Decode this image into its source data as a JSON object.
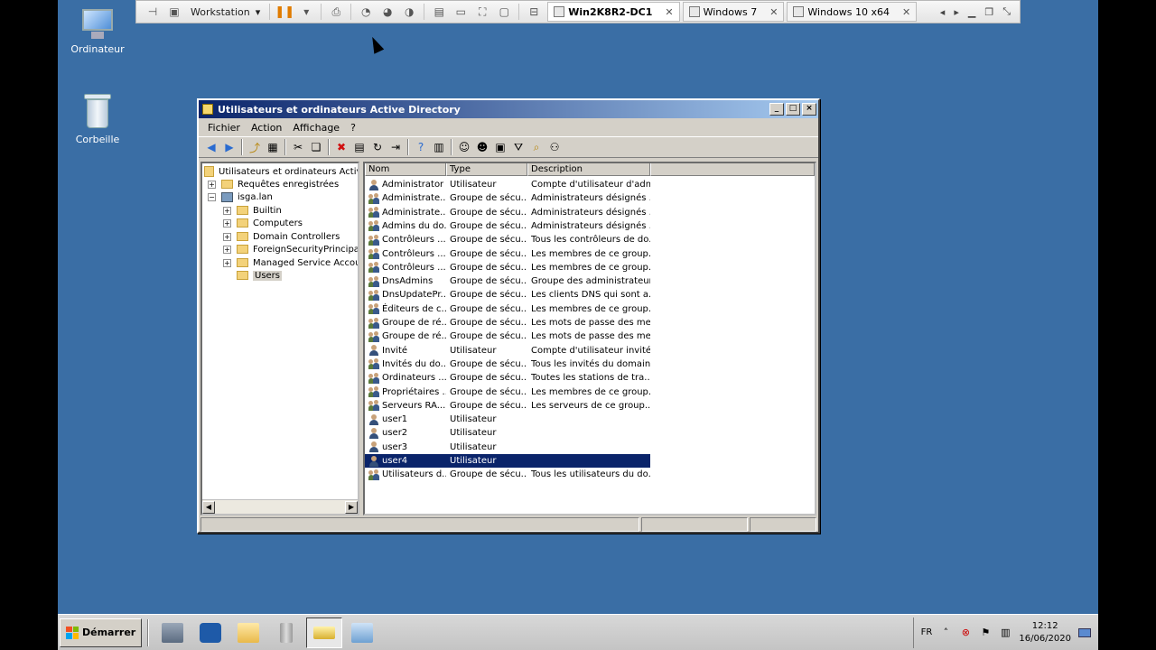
{
  "vmware": {
    "workstation_label": "Workstation",
    "tabs": [
      {
        "label": "Win2K8R2-DC1",
        "active": true
      },
      {
        "label": "Windows 7",
        "active": false
      },
      {
        "label": "Windows 10 x64",
        "active": false
      }
    ],
    "close_glyph": "✕"
  },
  "desktop": {
    "computer_label": "Ordinateur",
    "recycle_label": "Corbeille"
  },
  "window": {
    "title": "Utilisateurs et ordinateurs Active Directory",
    "menu": [
      "Fichier",
      "Action",
      "Affichage",
      "?"
    ]
  },
  "tree": {
    "root": "Utilisateurs et ordinateurs Active Di",
    "saved_queries": "Requêtes enregistrées",
    "domain": "isga.lan",
    "children": [
      "Builtin",
      "Computers",
      "Domain Controllers",
      "ForeignSecurityPrincipals",
      "Managed Service Accounts",
      "Users"
    ]
  },
  "list": {
    "columns": [
      "Nom",
      "Type",
      "Description"
    ],
    "rows": [
      {
        "name": "Administrator",
        "type": "Utilisateur",
        "desc": "Compte d'utilisateur d'adm...",
        "kind": "user"
      },
      {
        "name": "Administrate...",
        "type": "Groupe de sécu...",
        "desc": "Administrateurs désignés ...",
        "kind": "group"
      },
      {
        "name": "Administrate...",
        "type": "Groupe de sécu...",
        "desc": "Administrateurs désignés ...",
        "kind": "group"
      },
      {
        "name": "Admins du do...",
        "type": "Groupe de sécu...",
        "desc": "Administrateurs désignés ...",
        "kind": "group"
      },
      {
        "name": "Contrôleurs ...",
        "type": "Groupe de sécu...",
        "desc": "Tous les contrôleurs de do...",
        "kind": "group"
      },
      {
        "name": "Contrôleurs ...",
        "type": "Groupe de sécu...",
        "desc": "Les membres de ce group...",
        "kind": "group"
      },
      {
        "name": "Contrôleurs ...",
        "type": "Groupe de sécu...",
        "desc": "Les membres de ce group...",
        "kind": "group"
      },
      {
        "name": "DnsAdmins",
        "type": "Groupe de sécu...",
        "desc": "Groupe des administrateur...",
        "kind": "group"
      },
      {
        "name": "DnsUpdatePr...",
        "type": "Groupe de sécu...",
        "desc": "Les clients DNS qui sont a...",
        "kind": "group"
      },
      {
        "name": "Éditeurs de c...",
        "type": "Groupe de sécu...",
        "desc": "Les membres de ce group...",
        "kind": "group"
      },
      {
        "name": "Groupe de ré...",
        "type": "Groupe de sécu...",
        "desc": "Les mots de passe des me...",
        "kind": "group"
      },
      {
        "name": "Groupe de ré...",
        "type": "Groupe de sécu...",
        "desc": "Les mots de passe des me...",
        "kind": "group"
      },
      {
        "name": "Invité",
        "type": "Utilisateur",
        "desc": "Compte d'utilisateur invité",
        "kind": "user"
      },
      {
        "name": "Invités du do...",
        "type": "Groupe de sécu...",
        "desc": "Tous les invités du domaine",
        "kind": "group"
      },
      {
        "name": "Ordinateurs ...",
        "type": "Groupe de sécu...",
        "desc": "Toutes les stations de tra...",
        "kind": "group"
      },
      {
        "name": "Propriétaires ...",
        "type": "Groupe de sécu...",
        "desc": "Les membres de ce group...",
        "kind": "group"
      },
      {
        "name": "Serveurs RA...",
        "type": "Groupe de sécu...",
        "desc": "Les serveurs de ce group...",
        "kind": "group"
      },
      {
        "name": "user1",
        "type": "Utilisateur",
        "desc": "",
        "kind": "user"
      },
      {
        "name": "user2",
        "type": "Utilisateur",
        "desc": "",
        "kind": "user"
      },
      {
        "name": "user3",
        "type": "Utilisateur",
        "desc": "",
        "kind": "user"
      },
      {
        "name": "user4",
        "type": "Utilisateur",
        "desc": "",
        "kind": "user",
        "selected": true
      },
      {
        "name": "Utilisateurs d...",
        "type": "Groupe de sécu...",
        "desc": "Tous les utilisateurs du do...",
        "kind": "group"
      }
    ]
  },
  "taskbar": {
    "start_label": "Démarrer",
    "language": "FR",
    "time": "12:12",
    "date": "16/06/2020"
  },
  "colors": {
    "desktop": "#3a6ea5",
    "title_start": "#0a246a",
    "title_end": "#a6caf0",
    "selection": "#0a246a"
  }
}
